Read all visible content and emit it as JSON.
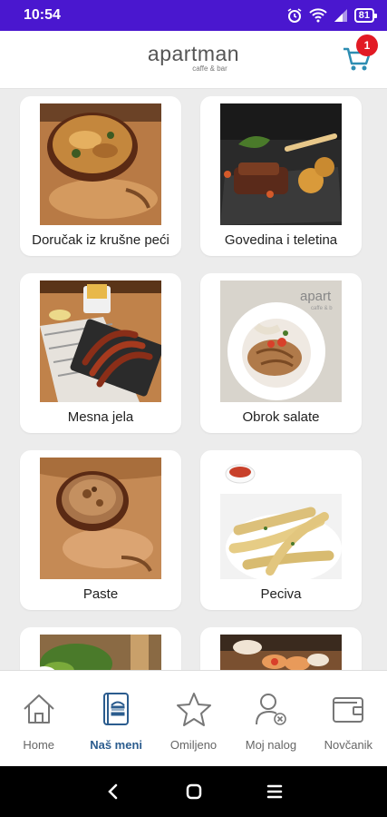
{
  "status_bar": {
    "time": "10:54",
    "battery": "81"
  },
  "header": {
    "brand_name": "apartman",
    "brand_sub": "caffe & bar",
    "cart_count": "1"
  },
  "categories": [
    {
      "label": "Doručak iz krušne peći",
      "image": "baked-dish-photo"
    },
    {
      "label": "Govedina i teletina",
      "image": "steak-plate-photo"
    },
    {
      "label": "Mesna jela",
      "image": "sausages-photo"
    },
    {
      "label": "Obrok salate",
      "image": "salad-bowl-photo"
    },
    {
      "label": "Paste",
      "image": "pasta-bowl-photo"
    },
    {
      "label": "Peciva",
      "image": "bread-sticks-photo"
    },
    {
      "label": "",
      "image": "salad-partial-photo"
    },
    {
      "label": "",
      "image": "sushi-partial-photo"
    }
  ],
  "bottom_nav": [
    {
      "label": "Home",
      "icon": "home-icon",
      "active": false
    },
    {
      "label": "Naš meni",
      "icon": "menu-book-icon",
      "active": true
    },
    {
      "label": "Omiljeno",
      "icon": "star-icon",
      "active": false
    },
    {
      "label": "Moj nalog",
      "icon": "user-icon",
      "active": false
    },
    {
      "label": "Novčanik",
      "icon": "wallet-icon",
      "active": false
    }
  ],
  "colors": {
    "status_bar": "#4a17cf",
    "accent": "#2b5c8e",
    "badge": "#e21a24",
    "background": "#ececec"
  }
}
